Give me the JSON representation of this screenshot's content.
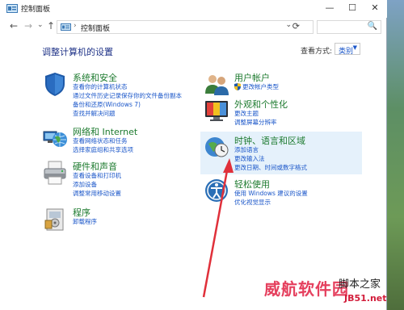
{
  "window": {
    "title": "控制面板",
    "minimize": "—",
    "maximize": "☐",
    "close": "✕"
  },
  "nav": {
    "back": "←",
    "forward": "→",
    "recent": "⌄",
    "up": "↑",
    "breadcrumb_sep": "›",
    "breadcrumb": "控制面板",
    "refresh": "⟳",
    "dropdown": "⌄",
    "search_icon": "🔍"
  },
  "header": {
    "heading": "调整计算机的设置",
    "view_by_label": "查看方式:",
    "view_by_value": "类别",
    "view_by_caret": "▼"
  },
  "categories": [
    {
      "title": "系统和安全",
      "icon": "shield-icon",
      "links": [
        "查看你的计算机状态",
        "通过文件历史记录保存你的文件备份副本",
        "备份和还原(Windows 7)",
        "查找并解决问题"
      ]
    },
    {
      "title": "网络和 Internet",
      "icon": "network-globe-icon",
      "links": [
        "查看网络状态和任务",
        "选择家庭组和共享选项"
      ]
    },
    {
      "title": "硬件和声音",
      "icon": "printer-icon",
      "links": [
        "查看设备和打印机",
        "添加设备",
        "调整常用移动设置"
      ]
    },
    {
      "title": "程序",
      "icon": "programs-icon",
      "links": [
        "卸载程序"
      ]
    },
    {
      "title": "用户帐户",
      "icon": "users-icon",
      "links": [
        "更改帐户类型"
      ]
    },
    {
      "title": "外观和个性化",
      "icon": "monitor-icon",
      "links": [
        "更改主题",
        "调整屏幕分辨率"
      ]
    },
    {
      "title": "时钟、语言和区域",
      "icon": "clock-globe-icon",
      "links": [
        "添加语言",
        "更改输入法",
        "更改日期、时间或数字格式"
      ]
    },
    {
      "title": "轻松使用",
      "icon": "ease-of-access-icon",
      "links": [
        "使用 Windows 建议的设置",
        "优化视觉显示"
      ]
    }
  ],
  "watermark": {
    "line1": "威航软件园",
    "line2": "脚本之家",
    "line3": "JB51.net"
  },
  "colors": {
    "category_title": "#1c7a2e",
    "link": "#1a56c9",
    "heading": "#1e3287",
    "highlight": "#e5f1fb",
    "arrow": "#e0303a"
  }
}
